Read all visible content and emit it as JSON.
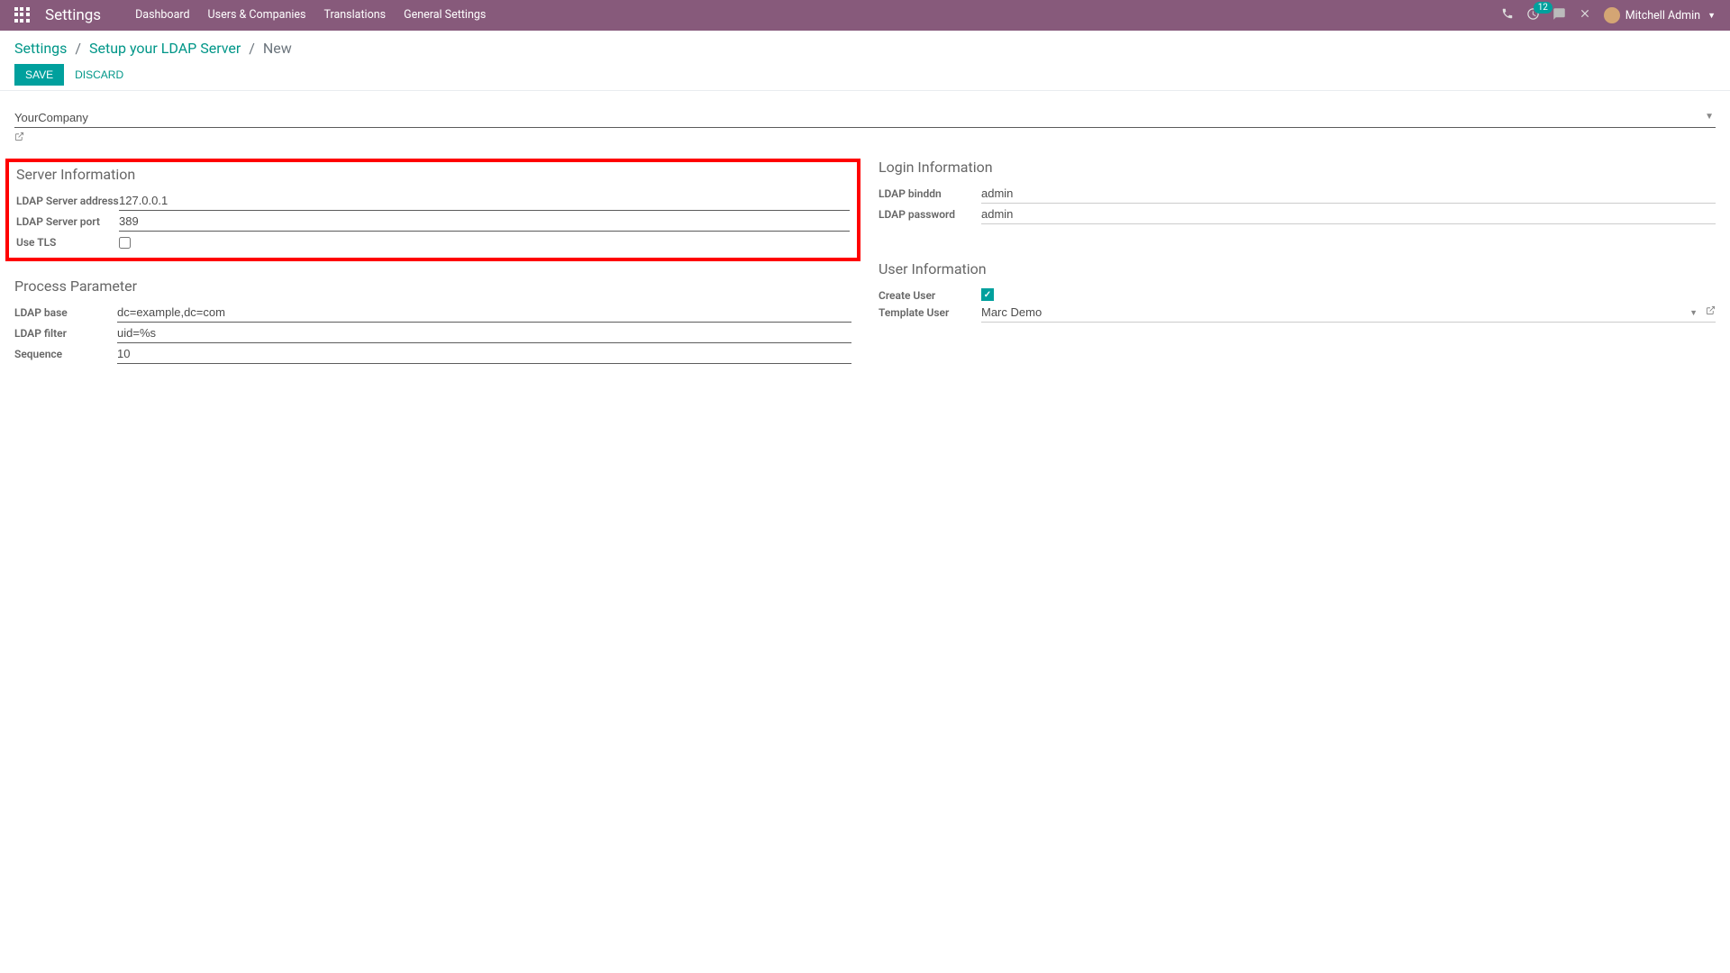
{
  "navbar": {
    "brand": "Settings",
    "menu": [
      "Dashboard",
      "Users & Companies",
      "Translations",
      "General Settings"
    ],
    "notification_count": "12",
    "user_name": "Mitchell Admin"
  },
  "breadcrumb": {
    "items": [
      "Settings",
      "Setup your LDAP Server",
      "New"
    ]
  },
  "buttons": {
    "save": "SAVE",
    "discard": "DISCARD"
  },
  "form": {
    "company": "YourCompany",
    "sections": {
      "server_info": {
        "title": "Server Information",
        "fields": {
          "ldap_server_address": {
            "label": "LDAP Server address",
            "value": "127.0.0.1"
          },
          "ldap_server_port": {
            "label": "LDAP Server port",
            "value": "389"
          },
          "use_tls": {
            "label": "Use TLS",
            "value": false
          }
        }
      },
      "login_info": {
        "title": "Login Information",
        "fields": {
          "ldap_binddn": {
            "label": "LDAP binddn",
            "value": "admin"
          },
          "ldap_password": {
            "label": "LDAP password",
            "value": "admin"
          }
        }
      },
      "process_param": {
        "title": "Process Parameter",
        "fields": {
          "ldap_base": {
            "label": "LDAP base",
            "value": "dc=example,dc=com"
          },
          "ldap_filter": {
            "label": "LDAP filter",
            "value": "uid=%s"
          },
          "sequence": {
            "label": "Sequence",
            "value": "10"
          }
        }
      },
      "user_info": {
        "title": "User Information",
        "fields": {
          "create_user": {
            "label": "Create User",
            "value": true
          },
          "template_user": {
            "label": "Template User",
            "value": "Marc Demo"
          }
        }
      }
    }
  }
}
